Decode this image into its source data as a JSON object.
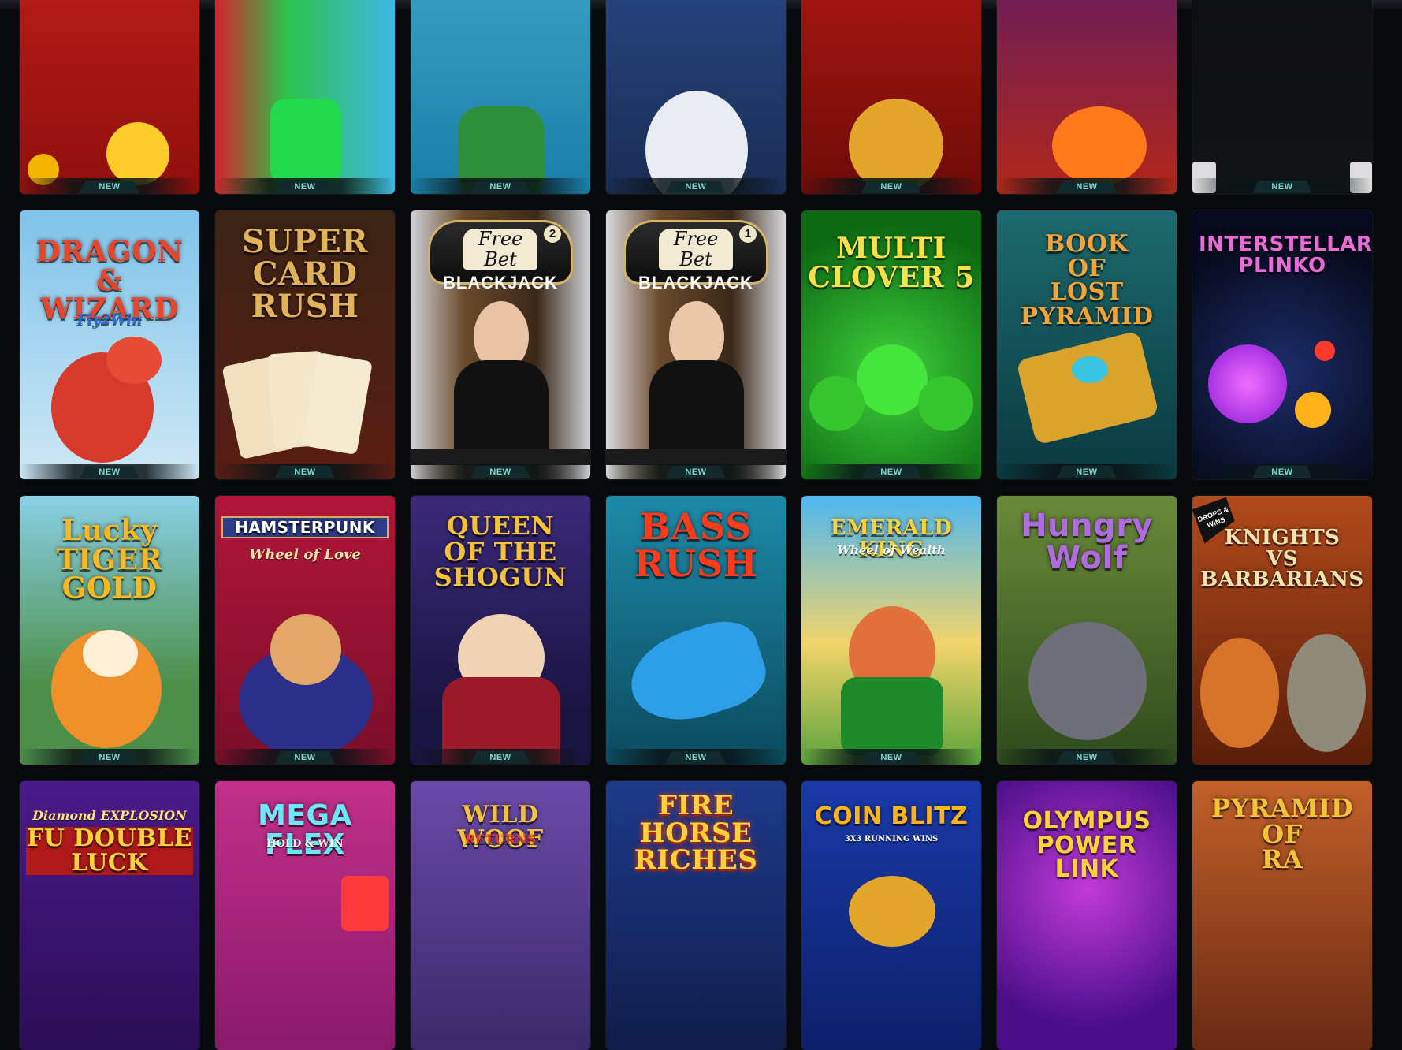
{
  "badge_label": "NEW",
  "rows": [
    {
      "tiles": [
        {
          "title": "",
          "subtitle": "",
          "new": true
        },
        {
          "title": "",
          "subtitle": "",
          "new": true
        },
        {
          "title": "",
          "subtitle": "",
          "new": true
        },
        {
          "title": "",
          "subtitle": "",
          "new": true
        },
        {
          "title": "",
          "subtitle": "",
          "new": true
        },
        {
          "title": "",
          "subtitle": "",
          "new": true
        },
        {
          "title": "",
          "subtitle": "",
          "new": true
        }
      ]
    },
    {
      "tiles": [
        {
          "title": "DRAGON\n&\nWIZARD",
          "subtitle": "Fly2Win",
          "new": true
        },
        {
          "title": "SUPER\nCARD\nRUSH",
          "subtitle": "",
          "new": true
        },
        {
          "title": "BLACKJACK",
          "subtitle": "Free Bet",
          "number": "2",
          "new": true
        },
        {
          "title": "BLACKJACK",
          "subtitle": "Free Bet",
          "number": "1",
          "new": true
        },
        {
          "title": "MULTI\nCLOVER 5",
          "subtitle": "",
          "new": true
        },
        {
          "title": "BOOK\nOF\nLOST PYRAMID",
          "subtitle": "",
          "new": true
        },
        {
          "title": "INTERSTELLAR\nPLINKO",
          "subtitle": "",
          "new": true
        }
      ]
    },
    {
      "tiles": [
        {
          "title": "Lucky\nTIGER\nGOLD",
          "subtitle": "",
          "new": true
        },
        {
          "title": "HAMSTERPUNK",
          "subtitle": "Wheel of Love",
          "new": true
        },
        {
          "title": "QUEEN\nOF THE\nSHOGUN",
          "subtitle": "",
          "new": true
        },
        {
          "title": "BASS\nRUSH",
          "subtitle": "",
          "new": true
        },
        {
          "title": "EMERALD KING",
          "subtitle": "Wheel of Wealth",
          "new": true
        },
        {
          "title": "Hungry\nWolf",
          "subtitle": "",
          "new": true
        },
        {
          "title": "KNIGHTS\nVS\nBARBARIANS",
          "subtitle": "",
          "badge": "DROPS & WINS",
          "new": false
        }
      ]
    },
    {
      "tiles": [
        {
          "title": "FU DOUBLE\nLUCK",
          "subtitle": "Diamond EXPLOSION",
          "new": false
        },
        {
          "title": "MEGA FLEX",
          "subtitle": "HOLD & WIN",
          "new": false
        },
        {
          "title": "WILD WOOF",
          "subtitle": "RETURNS",
          "new": false
        },
        {
          "title": "FIRE\nHORSE\nRICHES",
          "subtitle": "",
          "new": false
        },
        {
          "title": "COIN BLITZ",
          "subtitle": "3X3 RUNNING WINS",
          "new": false
        },
        {
          "title": "OLYMPUS\nPOWER LINK",
          "subtitle": "",
          "new": false
        },
        {
          "title": "PYRAMID\nOF\nRA",
          "subtitle": "",
          "new": false
        }
      ]
    }
  ],
  "colors": {
    "page_bg": "#07090c",
    "badge_text": "#7fd9cf",
    "badge_bg": "#132a2c"
  }
}
